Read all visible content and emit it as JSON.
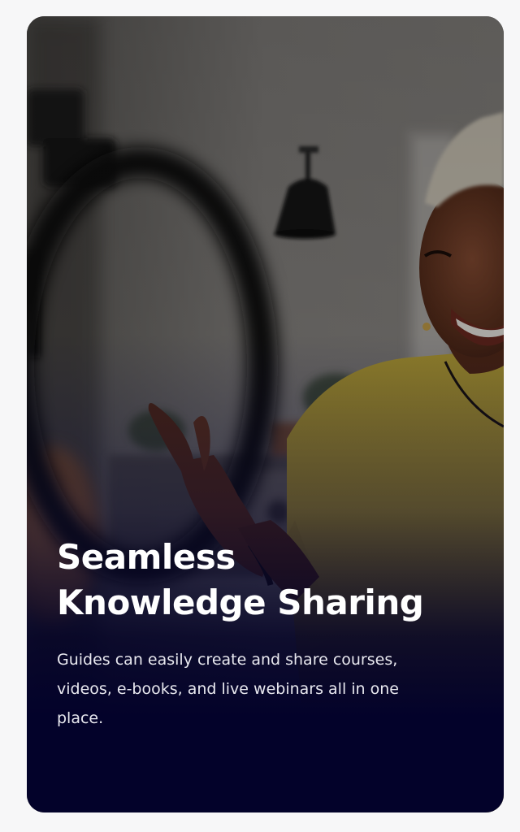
{
  "slide": {
    "title_line_1": "Seamless",
    "title_line_2": "Knowledge Sharing",
    "description": "Guides can easily create and share courses, videos, e-books, and live webinars all in one place."
  },
  "colors": {
    "page_background": "#f7f7f8",
    "overlay_bottom": "#03022a",
    "shirt": "#c9b13b",
    "text": "#ffffff"
  },
  "icons": {
    "hero_image": "woman-smiling-recording-with-ring-light"
  }
}
